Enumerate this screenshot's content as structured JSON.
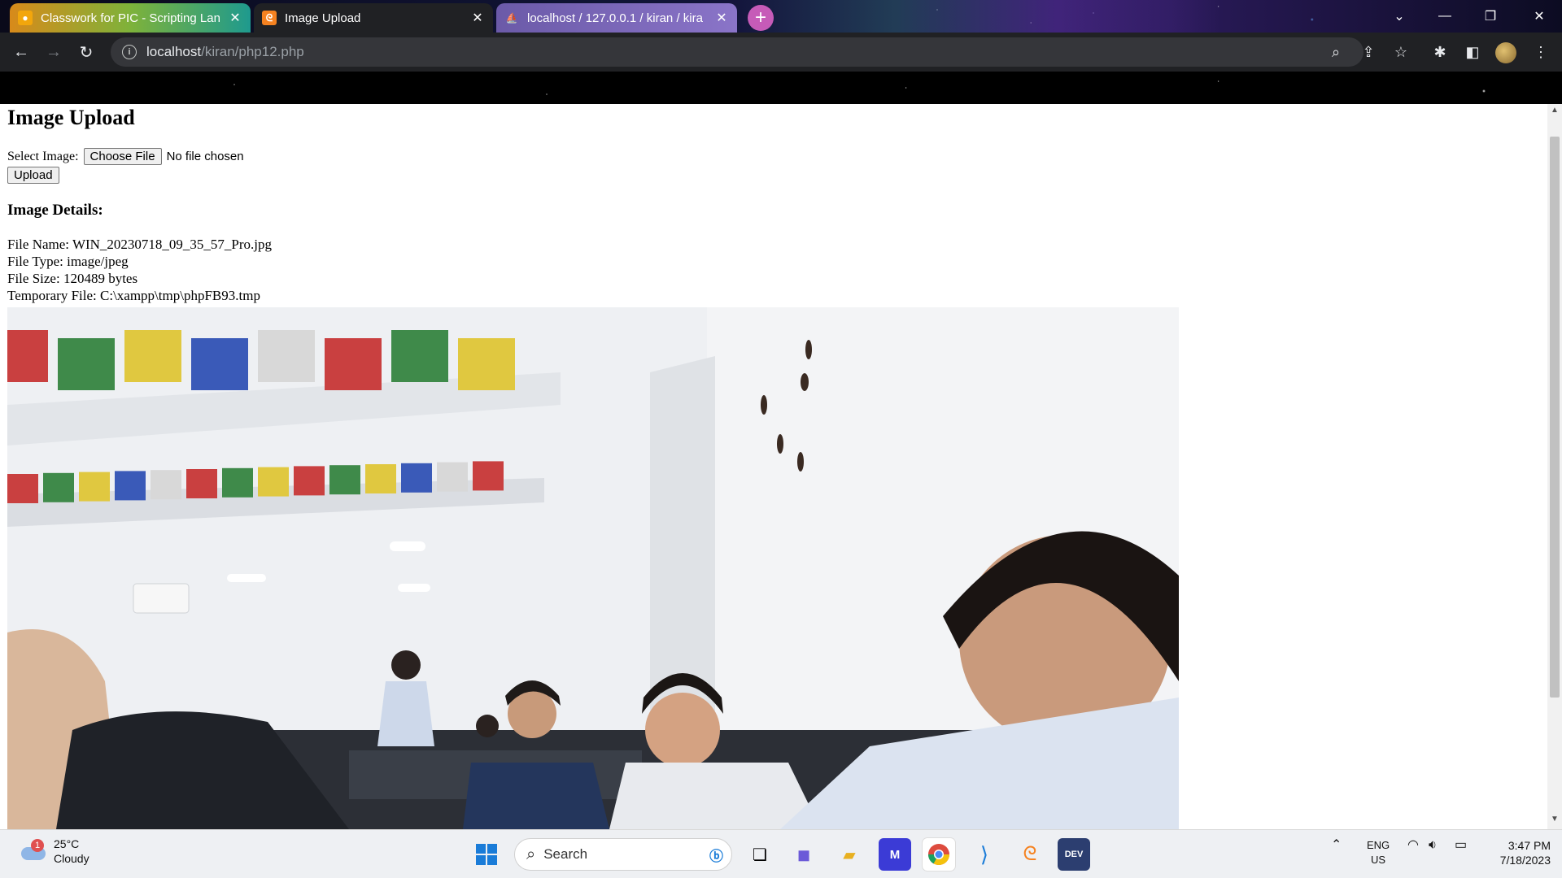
{
  "browser": {
    "tabs": [
      {
        "title": "Classwork for PIC - Scripting Lan",
        "icon": "classroom-icon"
      },
      {
        "title": "Image Upload",
        "icon": "xampp-icon"
      },
      {
        "title": "localhost / 127.0.0.1 / kiran / kira",
        "icon": "phpmyadmin-icon"
      }
    ],
    "new_tab": "+",
    "url_host": "localhost",
    "url_path": "/kiran/php12.php"
  },
  "page": {
    "title": "Image Upload",
    "select_label": "Select Image:",
    "choose_file": "Choose File",
    "no_file": "No file chosen",
    "upload": "Upload",
    "details_heading": "Image Details:",
    "file_name": "File Name: WIN_20230718_09_35_57_Pro.jpg",
    "file_type": "File Type: image/jpeg",
    "file_size": "File Size: 120489 bytes",
    "temp_file": "Temporary File: C:\\xampp\\tmp\\phpFB93.tmp",
    "flag_colors": [
      "#c94040",
      "#3f8a4a",
      "#e0c840",
      "#3a5ab8",
      "#d8d8d8",
      "#c94040",
      "#3f8a4a",
      "#e0c840"
    ]
  },
  "taskbar": {
    "weather_temp": "25°C",
    "weather_desc": "Cloudy",
    "weather_badge": "1",
    "search_placeholder": "Search",
    "lang_top": "ENG",
    "lang_bottom": "US",
    "time": "3:47 PM",
    "date": "7/18/2023"
  }
}
